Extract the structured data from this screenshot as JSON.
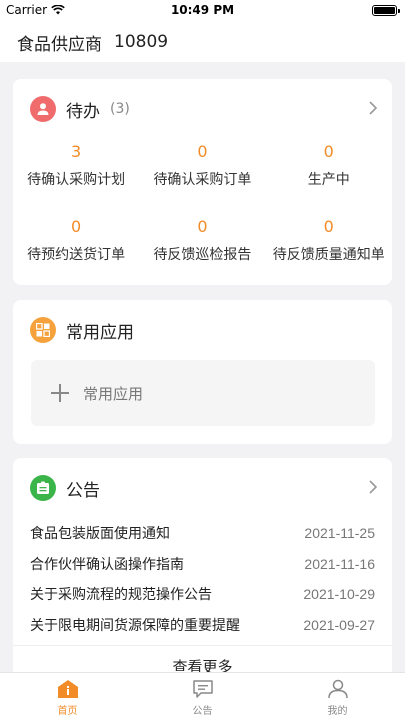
{
  "status_bar": {
    "carrier": "Carrier",
    "time": "10:49 PM"
  },
  "header": {
    "company_name": "食品供应商",
    "company_id": "10809"
  },
  "todo": {
    "title": "待办",
    "count": "(3)",
    "items": [
      {
        "value": "3",
        "label": "待确认采购计划"
      },
      {
        "value": "0",
        "label": "待确认采购订单"
      },
      {
        "value": "0",
        "label": "生产中"
      },
      {
        "value": "0",
        "label": "待预约送货订单"
      },
      {
        "value": "0",
        "label": "待反馈巡检报告"
      },
      {
        "value": "0",
        "label": "待反馈质量通知单"
      }
    ]
  },
  "apps": {
    "title": "常用应用",
    "add_label": "常用应用"
  },
  "notice": {
    "title": "公告",
    "items": [
      {
        "title": "食品包装版面使用通知",
        "date": "2021-11-25"
      },
      {
        "title": "合作伙伴确认函操作指南",
        "date": "2021-11-16"
      },
      {
        "title": "关于采购流程的规范操作公告",
        "date": "2021-10-29"
      },
      {
        "title": "关于限电期间货源保障的重要提醒",
        "date": "2021-09-27"
      }
    ],
    "more": "查看更多"
  },
  "tabs": [
    {
      "label": "首页",
      "active": true
    },
    {
      "label": "公告",
      "active": false
    },
    {
      "label": "我的",
      "active": false
    }
  ],
  "colors": {
    "accent": "#f28c28",
    "todo_icon": "#f06c6c",
    "apps_icon": "#f6a23c",
    "notice_icon": "#3bb54a"
  }
}
